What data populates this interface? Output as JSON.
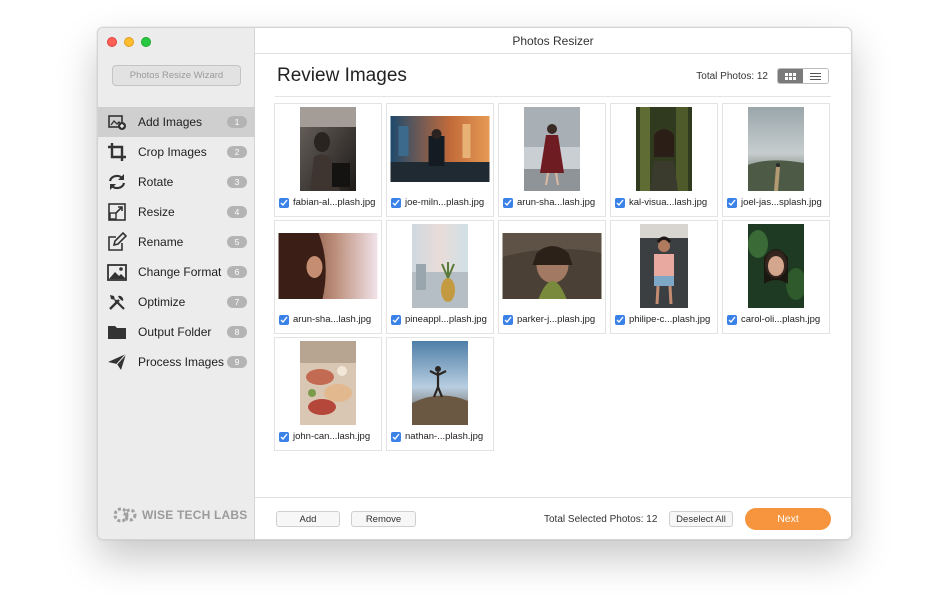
{
  "window": {
    "title": "Photos Resizer"
  },
  "sidebar": {
    "wizard_label": "Photos Resize Wizard",
    "items": [
      {
        "label": "Add Images",
        "num": "1",
        "icon": "add-images-icon",
        "active": true
      },
      {
        "label": "Crop Images",
        "num": "2",
        "icon": "crop-icon"
      },
      {
        "label": "Rotate",
        "num": "3",
        "icon": "rotate-icon"
      },
      {
        "label": "Resize",
        "num": "4",
        "icon": "resize-icon"
      },
      {
        "label": "Rename",
        "num": "5",
        "icon": "rename-icon"
      },
      {
        "label": "Change Format",
        "num": "6",
        "icon": "image-format-icon"
      },
      {
        "label": "Optimize",
        "num": "7",
        "icon": "tools-icon"
      },
      {
        "label": "Output Folder",
        "num": "8",
        "icon": "folder-icon"
      },
      {
        "label": "Process Images",
        "num": "9",
        "icon": "send-icon"
      }
    ],
    "brand": "WISE TECH LABS"
  },
  "main": {
    "heading": "Review Images",
    "total_photos": "Total Photos: 12",
    "view_mode": "grid"
  },
  "photos": [
    {
      "name": "fabian-al...plash.jpg",
      "checked": true,
      "orientation": "portrait"
    },
    {
      "name": "joe-miln...plash.jpg",
      "checked": true,
      "orientation": "landscape"
    },
    {
      "name": "arun-sha...lash.jpg",
      "checked": true,
      "orientation": "portrait"
    },
    {
      "name": "kal-visua...lash.jpg",
      "checked": true,
      "orientation": "portrait"
    },
    {
      "name": "joel-jas...splash.jpg",
      "checked": true,
      "orientation": "portrait"
    },
    {
      "name": "arun-sha...lash.jpg",
      "checked": true,
      "orientation": "landscape"
    },
    {
      "name": "pineappl...plash.jpg",
      "checked": true,
      "orientation": "portrait"
    },
    {
      "name": "parker-j...plash.jpg",
      "checked": true,
      "orientation": "landscape"
    },
    {
      "name": "philipe-c...plash.jpg",
      "checked": true,
      "orientation": "portrait"
    },
    {
      "name": "carol-oli...plash.jpg",
      "checked": true,
      "orientation": "portrait"
    },
    {
      "name": "john-can...lash.jpg",
      "checked": true,
      "orientation": "portrait"
    },
    {
      "name": "nathan-...plash.jpg",
      "checked": true,
      "orientation": "portrait"
    }
  ],
  "footer": {
    "add_label": "Add",
    "remove_label": "Remove",
    "selected_total": "Total Selected Photos: 12",
    "deselect_label": "Deselect All",
    "next_label": "Next"
  },
  "colors": {
    "accent": "#f7943e",
    "checkbox": "#3b82e8",
    "sidebar_bg": "#ececec"
  }
}
